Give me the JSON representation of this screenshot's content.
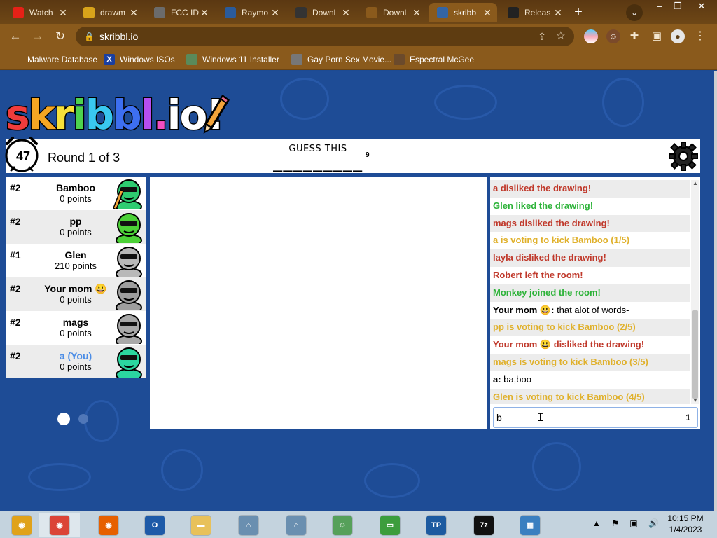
{
  "browser": {
    "tabs": [
      {
        "title": "Watch",
        "icon": "youtube-icon",
        "color": "#e62117"
      },
      {
        "title": "drawm",
        "icon": "dm-icon",
        "color": "#d8a31a"
      },
      {
        "title": "FCC ID",
        "icon": "globe-icon",
        "color": "#6b6b6b"
      },
      {
        "title": "Raymo",
        "icon": "r-icon",
        "color": "#2a5b9b"
      },
      {
        "title": "Downl",
        "icon": "aperture-icon",
        "color": "#333333"
      },
      {
        "title": "Downl",
        "icon": "download-icon",
        "color": "#8a5a1c"
      },
      {
        "title": "skribb",
        "icon": "skribbl-icon",
        "color": "#3465a4"
      },
      {
        "title": "Releas",
        "icon": "github-icon",
        "color": "#222222"
      }
    ],
    "url": "skribbl.io",
    "bookmarks": [
      {
        "label": "Malware Database",
        "icon": "folder-icon"
      },
      {
        "label": "Windows ISOs",
        "icon": "x-icon"
      },
      {
        "label": "Windows 11 Installer",
        "icon": "image-icon"
      },
      {
        "label": "Gay Porn Sex Movie...",
        "icon": "globe-icon"
      },
      {
        "label": "Espectral McGee",
        "icon": "avatar-icon"
      }
    ]
  },
  "game": {
    "logo": "skribbl.io!",
    "timer": "47",
    "round": "Round 1 of 3",
    "guess_header": "GUESS THIS",
    "word_hint": "_________",
    "word_length": "9",
    "players": [
      {
        "rank": "#2",
        "name": "Bamboo",
        "points": "0 points",
        "avatar_color": "#2ecc71",
        "is_you": false,
        "drawing": true
      },
      {
        "rank": "#2",
        "name": "pp",
        "points": "0 points",
        "avatar_color": "#4cd137",
        "is_you": false,
        "drawing": false
      },
      {
        "rank": "#1",
        "name": "Glen",
        "points": "210 points",
        "avatar_color": "#b8b8b8",
        "is_you": false,
        "drawing": false
      },
      {
        "rank": "#2",
        "name": "Your mom 😃",
        "points": "0 points",
        "avatar_color": "#9e9e9e",
        "is_you": false,
        "drawing": false
      },
      {
        "rank": "#2",
        "name": "mags",
        "points": "0 points",
        "avatar_color": "#a8a8a8",
        "is_you": false,
        "drawing": false
      },
      {
        "rank": "#2",
        "name": "a (You)",
        "points": "0 points",
        "avatar_color": "#2bd6a0",
        "is_you": true,
        "drawing": false
      }
    ],
    "chat": [
      {
        "who": "",
        "text": "a disliked the drawing!",
        "color": "#c0392b"
      },
      {
        "who": "",
        "text": "Glen liked the drawing!",
        "color": "#2db339"
      },
      {
        "who": "",
        "text": "mags disliked the drawing!",
        "color": "#c0392b"
      },
      {
        "who": "",
        "text": "a is voting to kick Bamboo (1/5)",
        "color": "#e0b12c"
      },
      {
        "who": "",
        "text": "layla disliked the drawing!",
        "color": "#c0392b"
      },
      {
        "who": "",
        "text": "Robert left the room!",
        "color": "#c0392b"
      },
      {
        "who": "",
        "text": "Monkey joined the room!",
        "color": "#2db339"
      },
      {
        "who": "Your mom 😃:",
        "text": " that alot of words-",
        "color": "#000000"
      },
      {
        "who": "",
        "text": "pp is voting to kick Bamboo (2/5)",
        "color": "#e0b12c"
      },
      {
        "who": "",
        "text": "Your mom 😃 disliked the drawing!",
        "color": "#c0392b"
      },
      {
        "who": "",
        "text": "mags is voting to kick Bamboo (3/5)",
        "color": "#e0b12c"
      },
      {
        "who": "a:",
        "text": " ba,boo",
        "color": "#000000"
      },
      {
        "who": "",
        "text": "Glen is voting to kick Bamboo (4/5)",
        "color": "#e0b12c"
      }
    ],
    "chat_input_value": "b",
    "chat_char_count": "1"
  },
  "taskbar": {
    "apps": [
      {
        "name": "chrome-canary-icon",
        "color": "#e0a21a"
      },
      {
        "name": "chrome-icon",
        "color": "#db4437"
      },
      {
        "name": "firefox-icon",
        "color": "#e66000"
      },
      {
        "name": "obama-logo-icon",
        "color": "#1d5aa8"
      },
      {
        "name": "file-explorer-icon",
        "color": "#e8c15a"
      },
      {
        "name": "network-computer-icon",
        "color": "#6a8fb0"
      },
      {
        "name": "network-computer-icon",
        "color": "#6a8fb0"
      },
      {
        "name": "users-icon",
        "color": "#56a05a"
      },
      {
        "name": "disk-icon",
        "color": "#3c9d3c"
      },
      {
        "name": "tp4-icon",
        "color": "#1c5aa0"
      },
      {
        "name": "7zip-icon",
        "color": "#111111"
      },
      {
        "name": "photos-icon",
        "color": "#3a7fc0"
      }
    ],
    "time": "10:15 PM",
    "date": "1/4/2023"
  }
}
